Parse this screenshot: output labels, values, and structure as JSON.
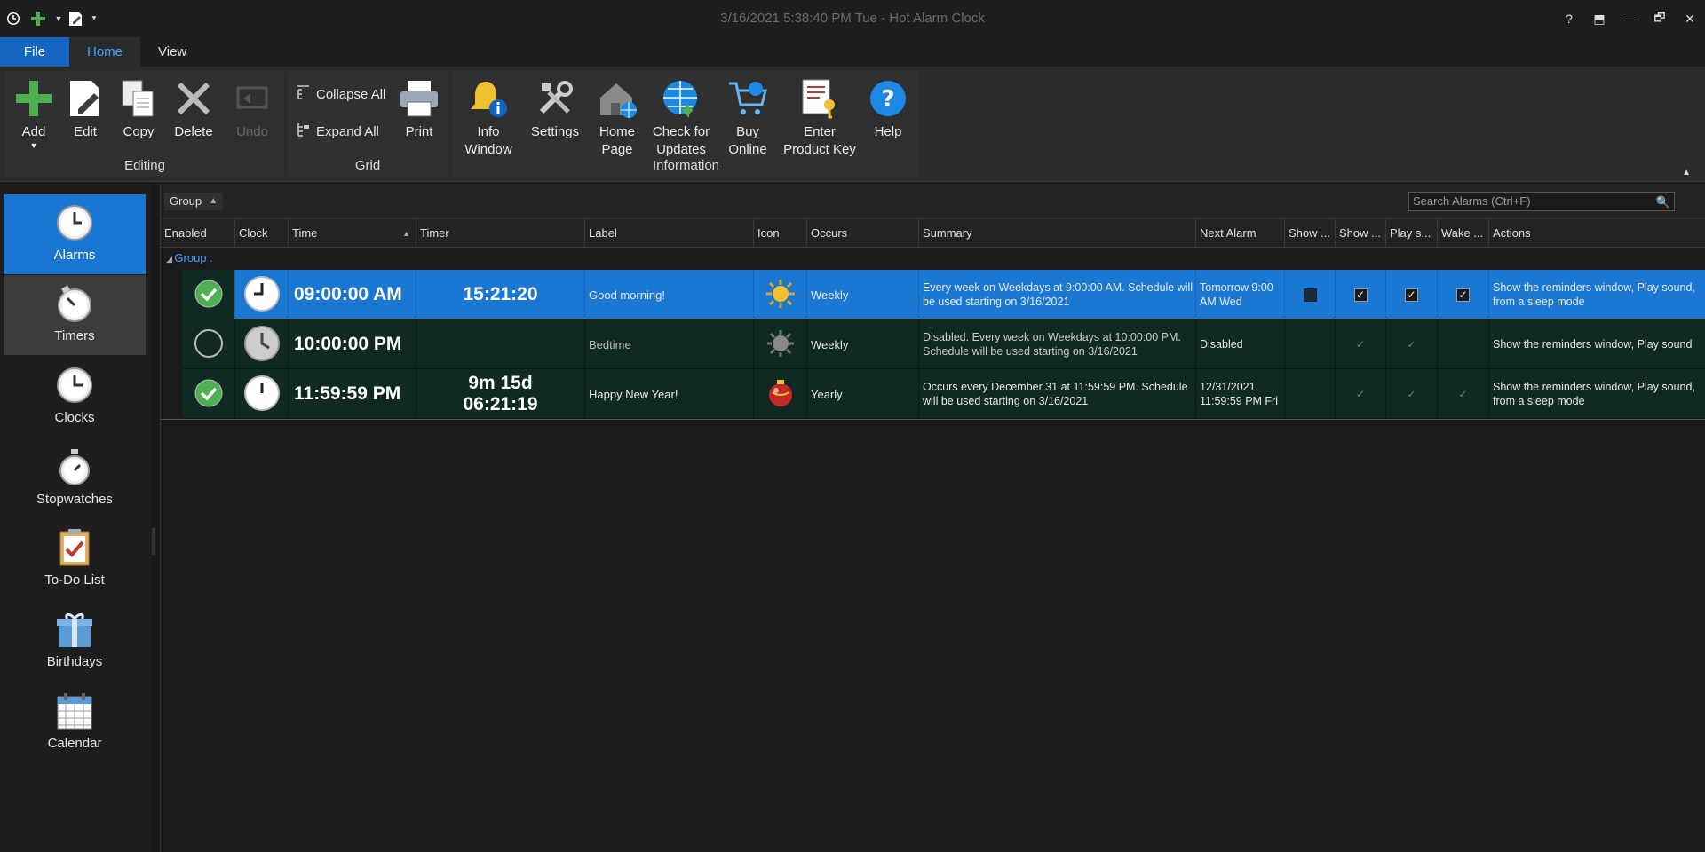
{
  "window": {
    "title": "3/16/2021 5:38:40 PM Tue - Hot Alarm Clock",
    "buttons": {
      "help": "?",
      "restore_ribbon": "⬒",
      "minimize": "—",
      "maximize": "🗗",
      "close": "✕"
    }
  },
  "tabs": [
    {
      "label": "File"
    },
    {
      "label": "Home"
    },
    {
      "label": "View"
    }
  ],
  "ribbon": {
    "groups": {
      "editing": "Editing",
      "grid": "Grid",
      "information": "Information"
    },
    "buttons": {
      "add": "Add",
      "edit": "Edit",
      "copy": "Copy",
      "delete": "Delete",
      "undo": "Undo",
      "collapse_all": "Collapse All",
      "expand_all": "Expand All",
      "print": "Print",
      "info_window_1": "Info",
      "info_window_2": "Window",
      "settings": "Settings",
      "home_page_1": "Home",
      "home_page_2": "Page",
      "check_updates_1": "Check for",
      "check_updates_2": "Updates",
      "buy_online_1": "Buy",
      "buy_online_2": "Online",
      "product_key_1": "Enter",
      "product_key_2": "Product Key",
      "help": "Help"
    }
  },
  "nav": [
    {
      "label": "Alarms"
    },
    {
      "label": "Timers"
    },
    {
      "label": "Clocks"
    },
    {
      "label": "Stopwatches"
    },
    {
      "label": "To-Do List"
    },
    {
      "label": "Birthdays"
    },
    {
      "label": "Calendar"
    }
  ],
  "grid": {
    "group_chip": "Group",
    "search_placeholder": "Search Alarms (Ctrl+F)",
    "group_row": "Group :",
    "columns": {
      "enabled": "Enabled",
      "clock": "Clock",
      "time": "Time",
      "timer": "Timer",
      "label": "Label",
      "icon": "Icon",
      "occurs": "Occurs",
      "summary": "Summary",
      "next_alarm": "Next Alarm",
      "show1": "Show ...",
      "show2": "Show ...",
      "play": "Play s...",
      "wake": "Wake ...",
      "actions": "Actions"
    },
    "rows": [
      {
        "time": "09:00:00 AM",
        "timer_1": "15:21:20",
        "timer_2": "",
        "label": "Good morning!",
        "occurs": "Weekly",
        "summary": "Every week on Weekdays at 9:00:00 AM. Schedule will be used starting on 3/16/2021",
        "next_1": "Tomorrow 9:00",
        "next_2": "AM Wed",
        "actions": "Show the reminders window, Play sound, from a sleep mode"
      },
      {
        "time": "10:00:00 PM",
        "timer_1": "",
        "timer_2": "",
        "label": "Bedtime",
        "occurs": "Weekly",
        "summary": "Disabled. Every week on Weekdays at 10:00:00 PM. Schedule will be used starting on 3/16/2021",
        "next_1": "Disabled",
        "next_2": "",
        "actions": "Show the reminders window, Play sound"
      },
      {
        "time": "11:59:59 PM",
        "timer_1": "9m 15d",
        "timer_2": "06:21:19",
        "label": "Happy New Year!",
        "occurs": "Yearly",
        "summary": "Occurs every December 31 at 11:59:59 PM. Schedule will be used starting on 3/16/2021",
        "next_1": "12/31/2021",
        "next_2": "11:59:59 PM Fri",
        "actions": "Show the reminders window, Play sound, from a sleep mode"
      }
    ],
    "check_glyph": "✓"
  },
  "colors": {
    "accent": "#1976d2",
    "selected_row": "#1a78d2",
    "row_bg": "#102a23",
    "enabled_green": "#4caf50"
  }
}
